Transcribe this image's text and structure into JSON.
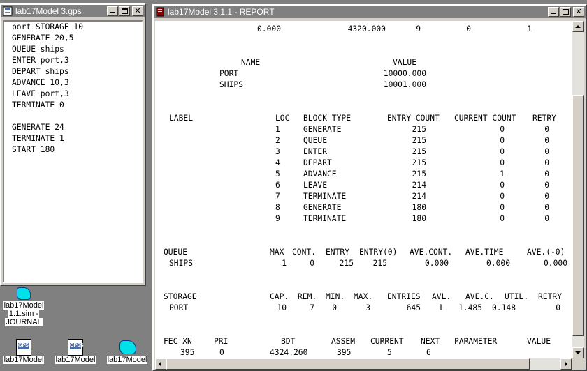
{
  "gps_window": {
    "title": "lab17Model 3.gps",
    "lines": [
      "port STORAGE 10",
      "GENERATE 20,5",
      "QUEUE ships",
      "ENTER port,3",
      "DEPART ships",
      "ADVANCE 10,3",
      "LEAVE port,3",
      "TERMINATE 0",
      "",
      "GENERATE 24",
      "TERMINATE 1",
      "START 180"
    ]
  },
  "report_window": {
    "title": "lab17Model 3.1.1 - REPORT",
    "top_row": [
      "0.000",
      "4320.000",
      "9",
      "0",
      "1"
    ],
    "names": {
      "headers": [
        "NAME",
        "VALUE"
      ],
      "rows": [
        {
          "name": "PORT",
          "value": "10000.000"
        },
        {
          "name": "SHIPS",
          "value": "10001.000"
        }
      ]
    },
    "blocks": {
      "headers": [
        "LABEL",
        "LOC",
        "BLOCK TYPE",
        "ENTRY COUNT",
        "CURRENT COUNT",
        "RETRY"
      ],
      "rows": [
        {
          "loc": "1",
          "type": "GENERATE",
          "entry": "215",
          "current": "0",
          "retry": "0"
        },
        {
          "loc": "2",
          "type": "QUEUE",
          "entry": "215",
          "current": "0",
          "retry": "0"
        },
        {
          "loc": "3",
          "type": "ENTER",
          "entry": "215",
          "current": "0",
          "retry": "0"
        },
        {
          "loc": "4",
          "type": "DEPART",
          "entry": "215",
          "current": "0",
          "retry": "0"
        },
        {
          "loc": "5",
          "type": "ADVANCE",
          "entry": "215",
          "current": "1",
          "retry": "0"
        },
        {
          "loc": "6",
          "type": "LEAVE",
          "entry": "214",
          "current": "0",
          "retry": "0"
        },
        {
          "loc": "7",
          "type": "TERMINATE",
          "entry": "214",
          "current": "0",
          "retry": "0"
        },
        {
          "loc": "8",
          "type": "GENERATE",
          "entry": "180",
          "current": "0",
          "retry": "0"
        },
        {
          "loc": "9",
          "type": "TERMINATE",
          "entry": "180",
          "current": "0",
          "retry": "0"
        }
      ]
    },
    "queue": {
      "headers": [
        "QUEUE",
        "MAX",
        "CONT.",
        "ENTRY",
        "ENTRY(0)",
        "AVE.CONT.",
        "AVE.TIME",
        "AVE.(-0)"
      ],
      "row": {
        "name": "SHIPS",
        "max": "1",
        "cont": "0",
        "entry": "215",
        "entry0": "215",
        "avecont": "0.000",
        "avetime": "0.000",
        "ave0": "0.000"
      }
    },
    "storage": {
      "headers": [
        "STORAGE",
        "CAP.",
        "REM.",
        "MIN.",
        "MAX.",
        "ENTRIES",
        "AVL.",
        "AVE.C.",
        "UTIL.",
        "RETRY"
      ],
      "row": {
        "name": "PORT",
        "cap": "10",
        "rem": "7",
        "min": "0",
        "max": "3",
        "entries": "645",
        "avl": "1",
        "avec": "1.485",
        "util": "0.148",
        "retry": "0"
      }
    },
    "fec": {
      "headers": [
        "FEC XN",
        "PRI",
        "BDT",
        "ASSEM",
        "CURRENT",
        "NEXT",
        "PARAMETER",
        "VALUE"
      ],
      "row": {
        "xn": "395",
        "pri": "0",
        "bdt": "4324.260",
        "assem": "395",
        "current": "5",
        "next": "6"
      }
    }
  },
  "desktop_icons": [
    {
      "label_1": "lab17Model",
      "label_2": "1.1.sim -",
      "label_3": "JOURNAL"
    },
    {
      "label": "lab17Model"
    },
    {
      "label": "lab17Model"
    },
    {
      "label": "lab17Model"
    }
  ],
  "colors": {
    "desktop": "#808080",
    "title_inactive": "#808080",
    "title_active": "#0a246a",
    "client_bg": "#ffffff"
  }
}
